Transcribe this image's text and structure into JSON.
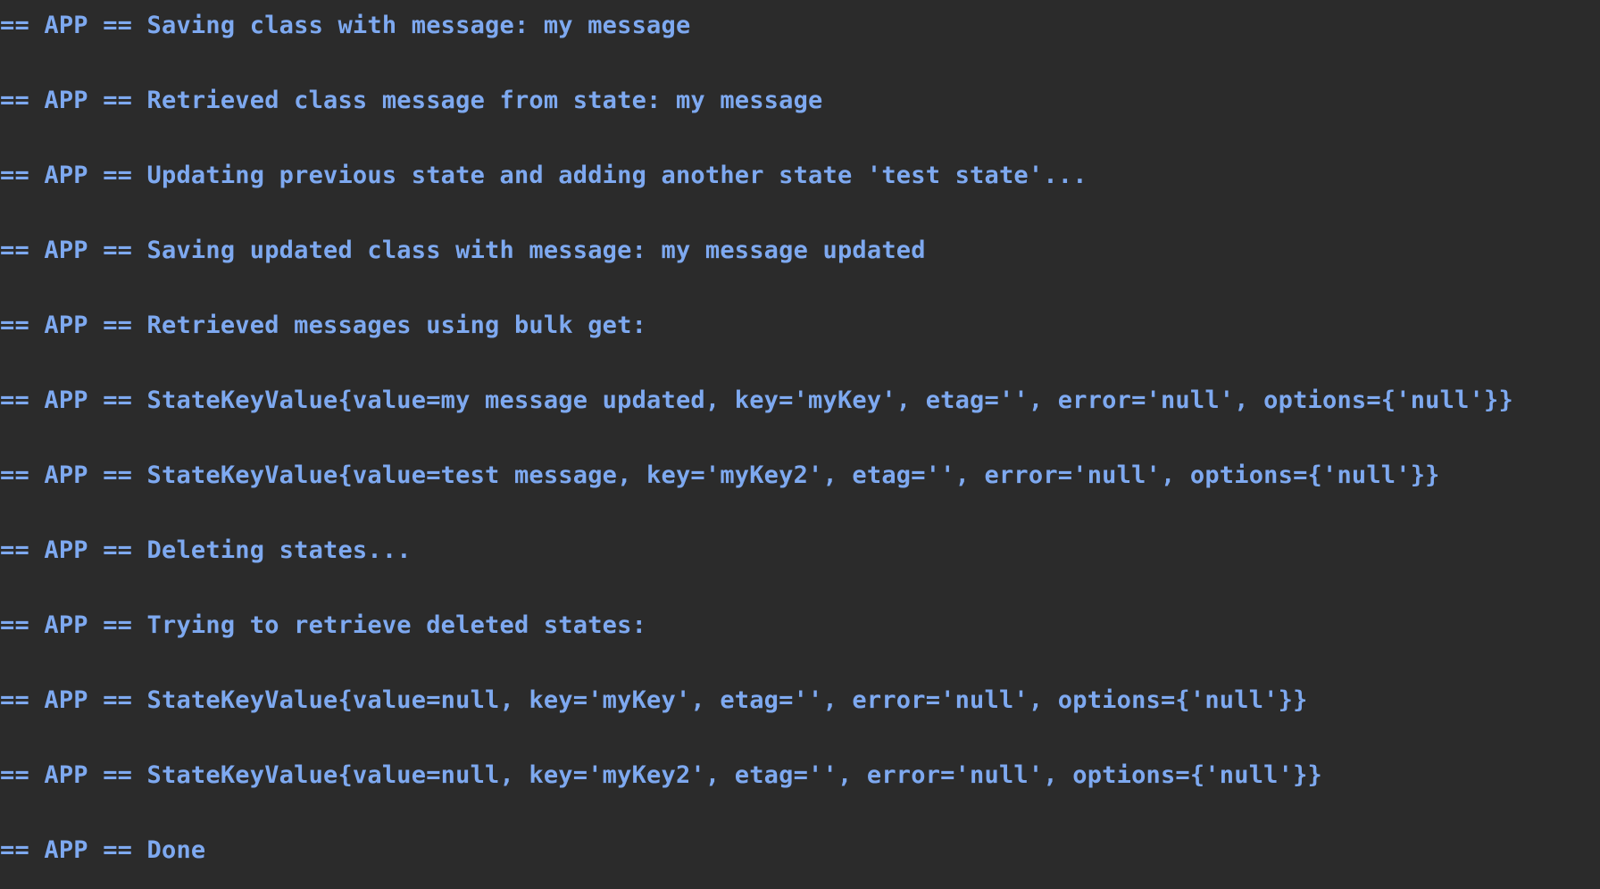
{
  "console": {
    "text_color": "#7ea9f0",
    "background_color": "#2b2b2b",
    "lines": [
      "== APP == Saving class with message: my message",
      "== APP == Retrieved class message from state: my message",
      "== APP == Updating previous state and adding another state 'test state'...",
      "== APP == Saving updated class with message: my message updated",
      "== APP == Retrieved messages using bulk get:",
      "== APP == StateKeyValue{value=my message updated, key='myKey', etag='', error='null', options={'null'}}",
      "== APP == StateKeyValue{value=test message, key='myKey2', etag='', error='null', options={'null'}}",
      "== APP == Deleting states...",
      "== APP == Trying to retrieve deleted states:",
      "== APP == StateKeyValue{value=null, key='myKey', etag='', error='null', options={'null'}}",
      "== APP == StateKeyValue{value=null, key='myKey2', etag='', error='null', options={'null'}}",
      "== APP == Done"
    ]
  }
}
